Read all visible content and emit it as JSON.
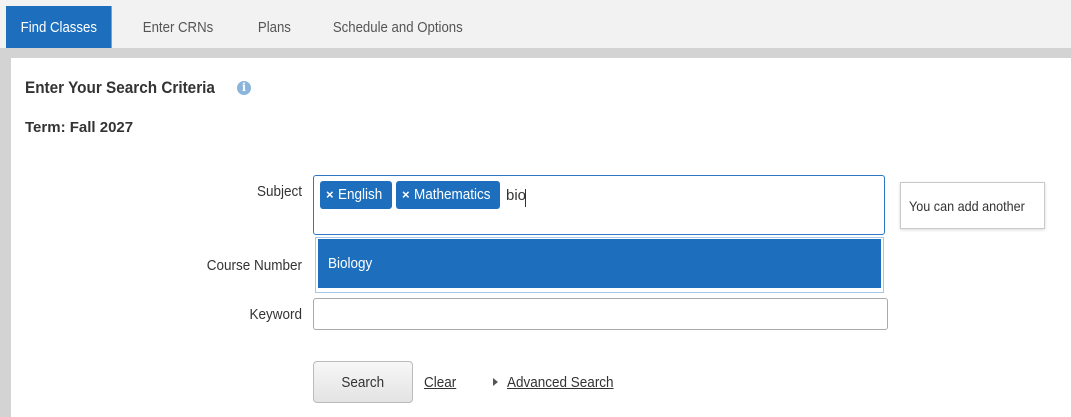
{
  "tabs": [
    {
      "label": "Find Classes",
      "active": true
    },
    {
      "label": "Enter CRNs",
      "active": false
    },
    {
      "label": "Plans",
      "active": false
    },
    {
      "label": "Schedule and Options",
      "active": false
    }
  ],
  "search": {
    "heading": "Enter Your Search Criteria",
    "info_icon": "info-icon",
    "term": "Term:  Fall 2027",
    "subject": {
      "label": "Subject",
      "chips": [
        {
          "remove": "×",
          "label": "English"
        },
        {
          "remove": "×",
          "label": "Mathematics"
        }
      ],
      "typed_value": "bio",
      "dropdown_option": "Biology",
      "tooltip": "You can add another"
    },
    "course_number": {
      "label": "Course Number",
      "value": ""
    },
    "keyword": {
      "label": "Keyword",
      "value": ""
    },
    "search_button": "Search",
    "clear_link": "Clear",
    "advanced_link": "Advanced Search"
  },
  "colors": {
    "accent": "#1d6fbd",
    "panel_border": "#d3d3d3"
  }
}
